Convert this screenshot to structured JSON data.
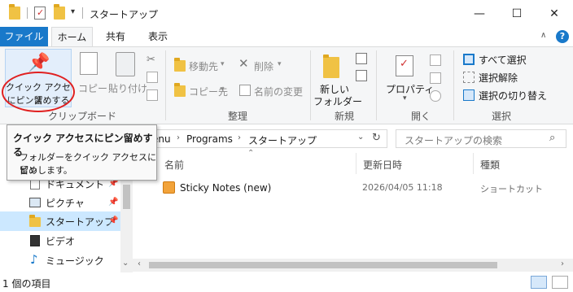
{
  "window": {
    "title": "スタートアップ",
    "controls": {
      "minimize": "—",
      "maximize": "☐",
      "close": "✕"
    }
  },
  "ribbon_tabs": [
    {
      "label": "ファイル",
      "active_file": true
    },
    {
      "label": "ホーム",
      "selected": true
    },
    {
      "label": "共有"
    },
    {
      "label": "表示"
    }
  ],
  "ribbon": {
    "clipboard": {
      "pin_label_line1": "クイック アクセス",
      "pin_label_line2": "にピン留めする",
      "copy": "コピー",
      "paste": "貼り付け",
      "group_label": "クリップボード"
    },
    "organize": {
      "move_to": "移動先",
      "copy_to": "コピー先",
      "delete": "削除",
      "rename": "名前の変更",
      "group_label": "整理"
    },
    "new": {
      "new_folder_line1": "新しい",
      "new_folder_line2": "フォルダー",
      "group_label": "新規"
    },
    "open": {
      "properties": "プロパティ",
      "group_label": "開く"
    },
    "select": {
      "select_all": "すべて選択",
      "select_none": "選択解除",
      "invert": "選択の切り替え",
      "group_label": "選択"
    }
  },
  "address": {
    "path_prefix": "enu",
    "crumb1": "Programs",
    "crumb2": "スタートアップ",
    "search_placeholder": "スタートアップの検索"
  },
  "tooltip": {
    "title": "クイック アクセスにピン留めする",
    "body_line1": "フォルダーをクイック アクセスにピン",
    "body_line2": "留めします。"
  },
  "nav_items": [
    {
      "label": "ドキュメント",
      "icon": "document-icon"
    },
    {
      "label": "ピクチャ",
      "icon": "pictures-icon"
    },
    {
      "label": "スタートアップ",
      "icon": "folder-icon",
      "selected": true
    },
    {
      "label": "ビデオ",
      "icon": "video-icon"
    },
    {
      "label": "ミュージック",
      "icon": "music-icon"
    }
  ],
  "columns": {
    "name": "名前",
    "modified": "更新日時",
    "type": "種類"
  },
  "files": [
    {
      "name": "Sticky Notes (new)",
      "modified": "2026/04/05 11:18",
      "type": "ショートカット"
    }
  ],
  "status": {
    "item_count": "1 個の項目"
  },
  "colors": {
    "accent": "#1979ca",
    "selected_row": "#cce8ff",
    "highlight_circle": "#e02020"
  }
}
